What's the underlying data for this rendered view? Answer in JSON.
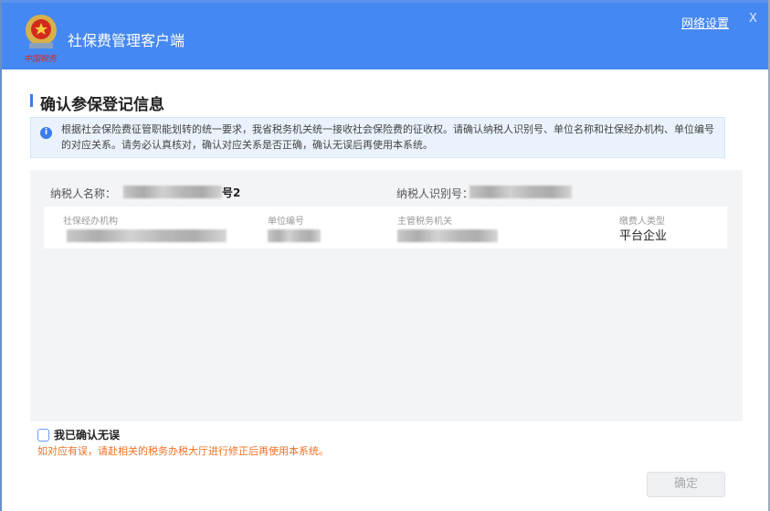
{
  "header": {
    "app_title": "社保费管理客户端",
    "network_settings": "网络设置",
    "close": "X",
    "logo_text": "中国税务"
  },
  "page": {
    "title": "确认参保登记信息",
    "notice": "根据社会保险费征管职能划转的统一要求，我省税务机关统一接收社会保险费的征收权。请确认纳税人识别号、单位名称和社保经办机构、单位编号的对应关系。请务必认真核对，确认对应关系是否正确，确认无误后再使用本系统。"
  },
  "taxpayer": {
    "name_label": "纳税人名称：",
    "name_suffix": "号2",
    "id_label": "纳税人识别号："
  },
  "card": {
    "headers": [
      "社保经办机构",
      "单位编号",
      "主管税务机关",
      "缴费人类型"
    ],
    "payer_type": "平台企业"
  },
  "footer": {
    "confirm_checkbox": "我已确认无误",
    "warning": "如对应有误，请赴相关的税务办税大厅进行修正后再使用本系统。",
    "ok_button": "确定"
  }
}
